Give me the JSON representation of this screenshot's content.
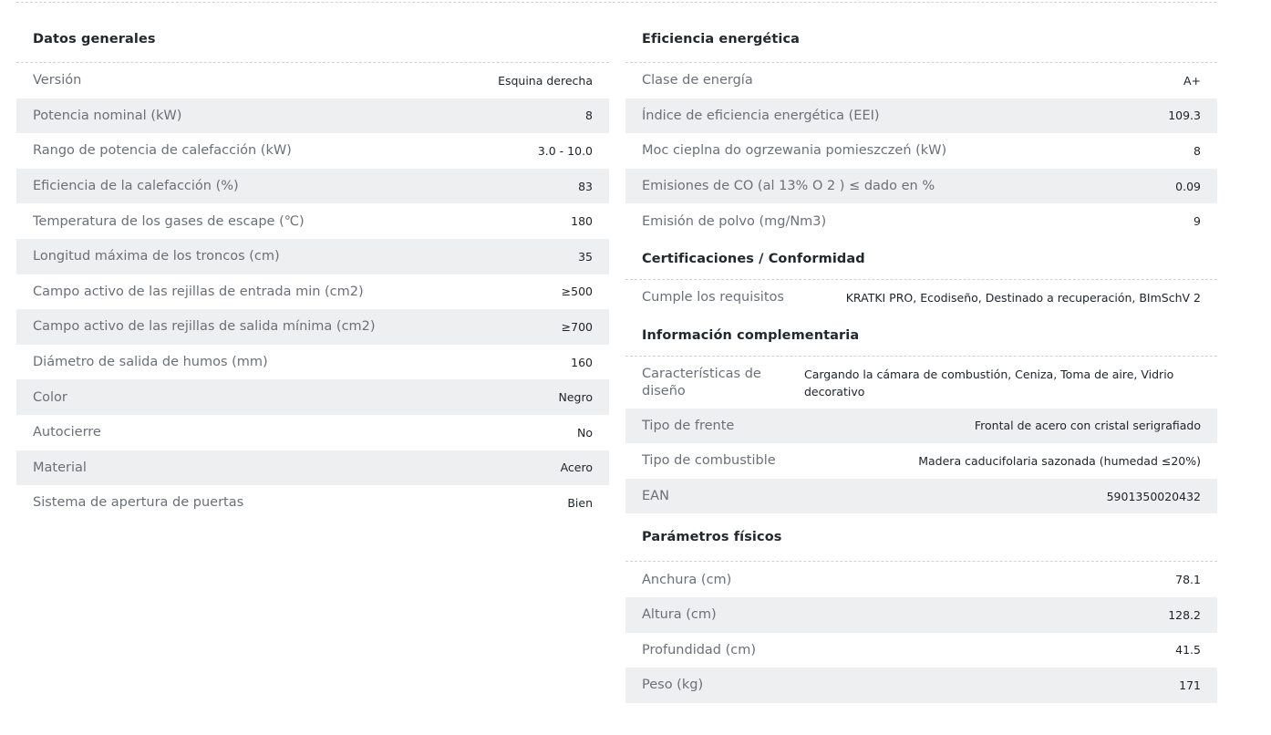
{
  "general": {
    "title": "Datos generales",
    "rows": [
      {
        "label": "Versión",
        "value": "Esquina derecha"
      },
      {
        "label": "Potencia nominal (kW)",
        "value": "8"
      },
      {
        "label": "Rango de potencia de calefacción (kW)",
        "value": "3.0 - 10.0"
      },
      {
        "label": "Eficiencia de la calefacción (%)",
        "value": "83"
      },
      {
        "label": "Temperatura de los gases de escape (℃)",
        "value": "180"
      },
      {
        "label": "Longitud máxima de los troncos (cm)",
        "value": "35"
      },
      {
        "label": "Campo activo de las rejillas de entrada min (cm2)",
        "value": "≥500"
      },
      {
        "label": "Campo activo de las rejillas de salida mínima (cm2)",
        "value": "≥700"
      },
      {
        "label": "Diámetro de salida de humos (mm)",
        "value": "160"
      },
      {
        "label": "Color",
        "value": "Negro"
      },
      {
        "label": "Autocierre",
        "value": "No"
      },
      {
        "label": "Material",
        "value": "Acero"
      },
      {
        "label": "Sistema de apertura de puertas",
        "value": "Bien"
      }
    ]
  },
  "energy": {
    "title": "Eficiencia energética",
    "rows": [
      {
        "label": "Clase de energía",
        "value": "A+"
      },
      {
        "label": "Índice de eficiencia energética (EEI)",
        "value": "109.3"
      },
      {
        "label": "Moc cieplna do ogrzewania pomieszczeń (kW)",
        "value": "8"
      },
      {
        "label": "Emisiones de CO (al 13% O 2 ) ≤ dado en %",
        "value": "0.09"
      },
      {
        "label": "Emisión de polvo (mg/Nm3)",
        "value": "9"
      }
    ]
  },
  "certifications": {
    "title": "Certificaciones / Conformidad",
    "rows": [
      {
        "label": "Cumple los requisitos",
        "value": "KRATKI PRO, Ecodiseño, Destinado a recuperación, BImSchV 2"
      }
    ]
  },
  "complementary": {
    "title": "Información complementaria",
    "rows": [
      {
        "label": "Características de diseño",
        "value": "Cargando la cámara de combustión, Ceniza, Toma de aire, Vidrio decorativo"
      },
      {
        "label": "Tipo de frente",
        "value": "Frontal de acero con cristal serigrafiado"
      },
      {
        "label": "Tipo de combustible",
        "value": "Madera caducifolaria sazonada (humedad ≤20%)"
      },
      {
        "label": "EAN",
        "value": "5901350020432"
      }
    ]
  },
  "physical": {
    "title": "Parámetros físicos",
    "rows": [
      {
        "label": "Anchura (cm)",
        "value": "78.1"
      },
      {
        "label": "Altura (cm)",
        "value": "128.2"
      },
      {
        "label": "Profundidad (cm)",
        "value": "41.5"
      },
      {
        "label": "Peso (kg)",
        "value": "171"
      }
    ]
  }
}
